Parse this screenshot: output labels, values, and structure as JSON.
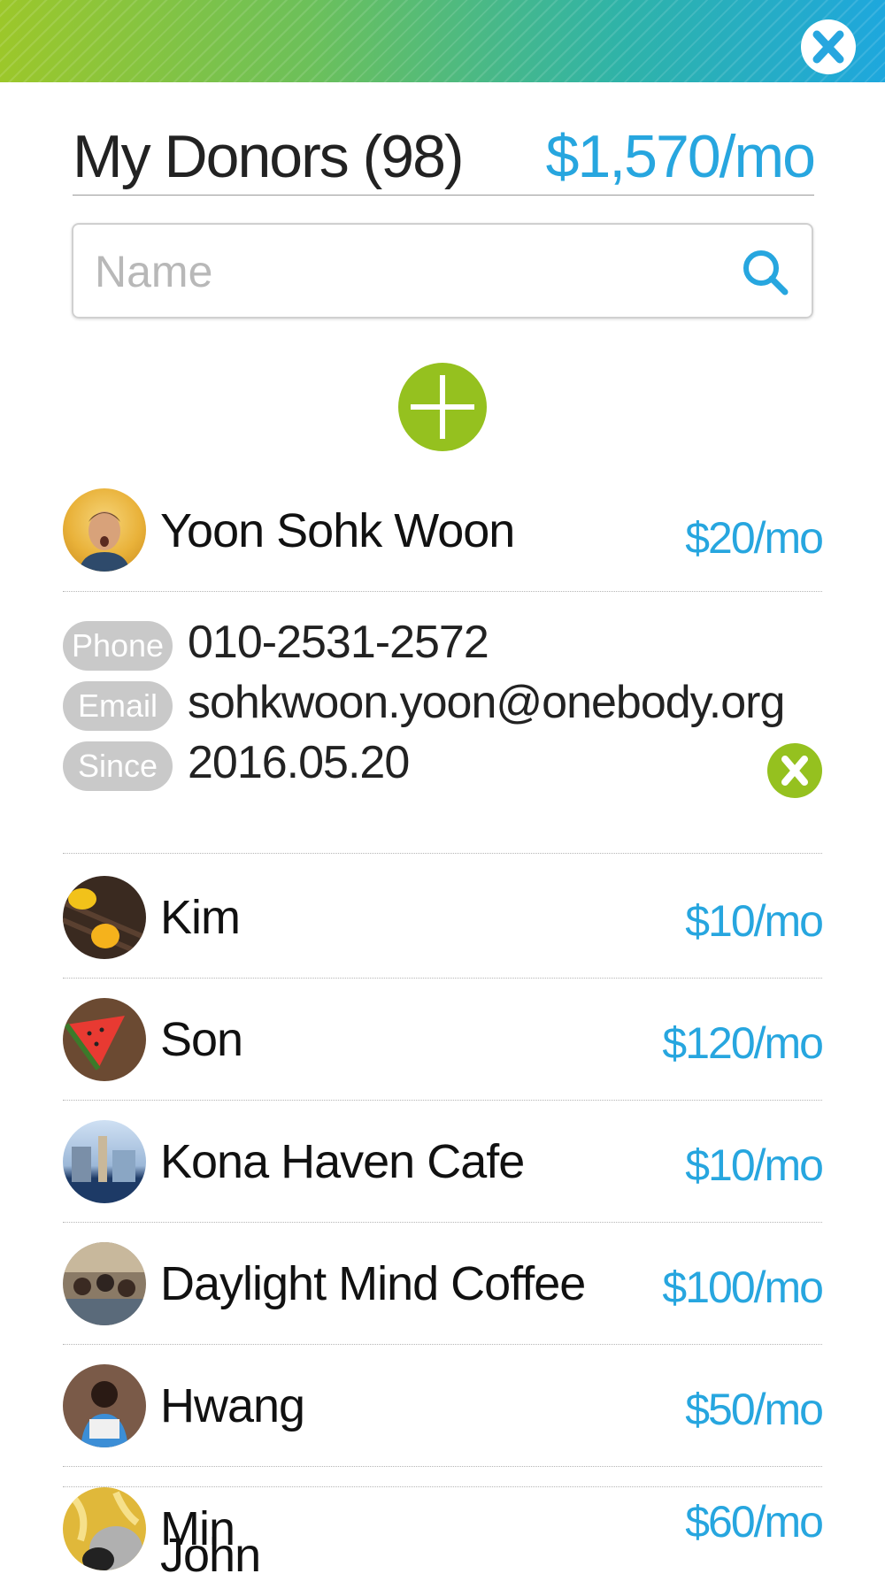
{
  "header": {
    "title": "My Donors (98)",
    "total": "$1,570/mo"
  },
  "search": {
    "placeholder": "Name",
    "value": ""
  },
  "expanded": {
    "name": "Yoon Sohk Woon",
    "amount": "$20/mo",
    "phone_label": "Phone",
    "phone": "010-2531-2572",
    "email_label": "Email",
    "email": "sohkwoon.yoon@onebody.org",
    "since_label": "Since",
    "since": "2016.05.20"
  },
  "donors": [
    {
      "name": "Kim",
      "amount": "$10/mo"
    },
    {
      "name": "Son",
      "amount": "$120/mo"
    },
    {
      "name": "Kona Haven Cafe",
      "amount": "$10/mo"
    },
    {
      "name": "Daylight Mind Coffee",
      "amount": "$100/mo"
    },
    {
      "name": "Hwang",
      "amount": "$50/mo"
    },
    {
      "name": "Min",
      "amount": "$60/mo"
    },
    {
      "name": "John",
      "amount": ""
    }
  ],
  "icons": {
    "close": "close-icon",
    "search": "search-icon",
    "add": "plus-icon",
    "remove": "close-icon"
  },
  "colors": {
    "accent": "#27a6df",
    "green": "#95c11f",
    "tag": "#c9c9c9"
  }
}
